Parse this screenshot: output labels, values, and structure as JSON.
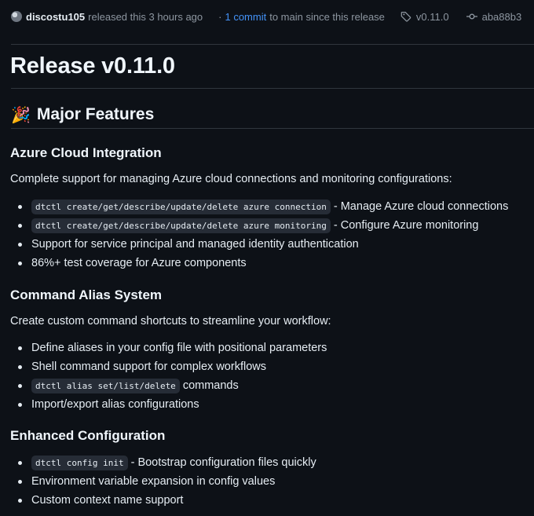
{
  "header": {
    "author": "discostu105",
    "released_text": "released this 3 hours ago",
    "separator": "·",
    "commits_link": "1 commit",
    "commits_suffix": "to main since this release",
    "tag": "v0.11.0",
    "commit_sha": "aba88b3"
  },
  "release": {
    "title": "Release v0.11.0",
    "section_emoji": "🎉",
    "section_title": "Major Features",
    "azure": {
      "heading": "Azure Cloud Integration",
      "intro": "Complete support for managing Azure cloud connections and monitoring configurations:",
      "items": [
        {
          "code": "dtctl create/get/describe/update/delete azure connection",
          "text": "- Manage Azure cloud connections"
        },
        {
          "code": "dtctl create/get/describe/update/delete azure monitoring",
          "text": "- Configure Azure monitoring"
        },
        {
          "code": "",
          "text": "Support for service principal and managed identity authentication"
        },
        {
          "code": "",
          "text": "86%+ test coverage for Azure components"
        }
      ]
    },
    "alias": {
      "heading": "Command Alias System",
      "intro": "Create custom command shortcuts to streamline your workflow:",
      "items": [
        {
          "code": "",
          "text": "Define aliases in your config file with positional parameters"
        },
        {
          "code": "",
          "text": "Shell command support for complex workflows"
        },
        {
          "code": "dtctl alias set/list/delete",
          "text": "commands"
        },
        {
          "code": "",
          "text": "Import/export alias configurations"
        }
      ]
    },
    "config": {
      "heading": "Enhanced Configuration",
      "items": [
        {
          "code": "dtctl config init",
          "text": "- Bootstrap configuration files quickly"
        },
        {
          "code": "",
          "text": "Environment variable expansion in config values"
        },
        {
          "code": "",
          "text": "Custom context name support"
        }
      ]
    }
  }
}
